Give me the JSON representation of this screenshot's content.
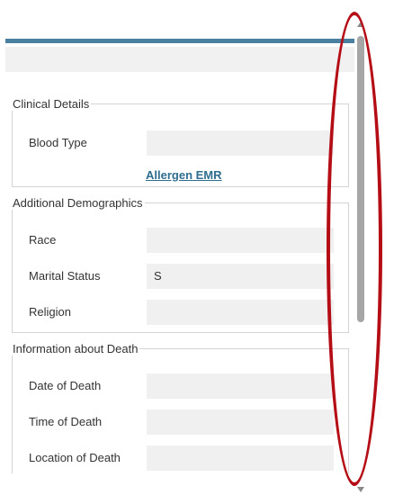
{
  "clinical": {
    "legend": "Clinical Details",
    "blood_type_label": "Blood Type",
    "blood_type_value": "",
    "allergen_link": "Allergen EMR"
  },
  "demographics": {
    "legend": "Additional Demographics",
    "race_label": "Race",
    "race_value": "",
    "marital_label": "Marital Status",
    "marital_value": "S",
    "religion_label": "Religion",
    "religion_value": ""
  },
  "death": {
    "legend": "Information about Death",
    "date_label": "Date of Death",
    "date_value": "",
    "time_label": "Time of Death",
    "time_value": "",
    "location_label": "Location of Death",
    "location_value": ""
  },
  "colors": {
    "accent": "#4a7fa0",
    "link": "#2f6d8f",
    "highlight": "#b50d16"
  },
  "icons": [
    "scroll-up-arrow-icon",
    "scroll-down-arrow-icon"
  ]
}
